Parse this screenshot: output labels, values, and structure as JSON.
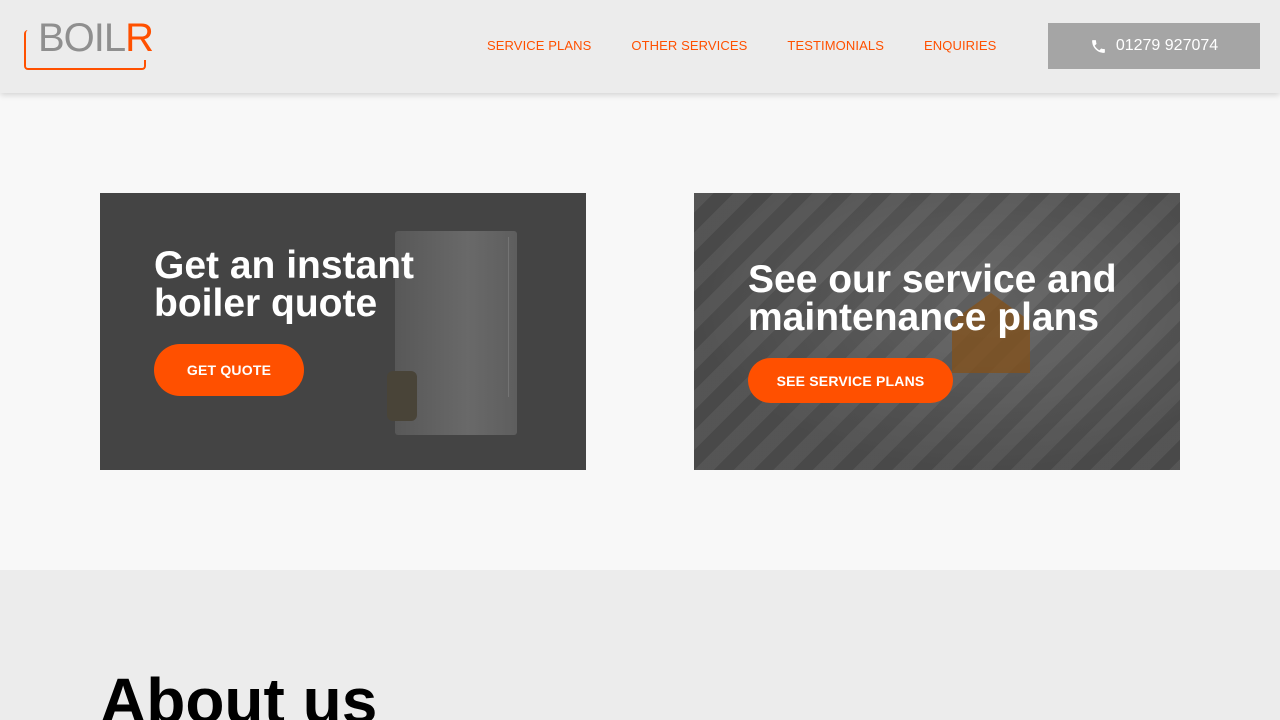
{
  "header": {
    "logo": {
      "text_main": "BOIL",
      "text_accent": "R"
    },
    "nav": [
      "SERVICE PLANS",
      "OTHER SERVICES",
      "TESTIMONIALS",
      "ENQUIRIES"
    ],
    "phone": {
      "number": "01279 927074",
      "icon": "phone-icon"
    }
  },
  "cards": {
    "quote": {
      "title": "Get an instant\nboiler quote",
      "button": "GET QUOTE"
    },
    "plans": {
      "title": "See our service and\nmaintenance plans",
      "button": "SEE SERVICE PLANS"
    }
  },
  "about": {
    "heading": "About us"
  },
  "colors": {
    "accent": "#ff5000",
    "header_bg": "#ececec",
    "phone_bg": "#a5a5a5"
  }
}
